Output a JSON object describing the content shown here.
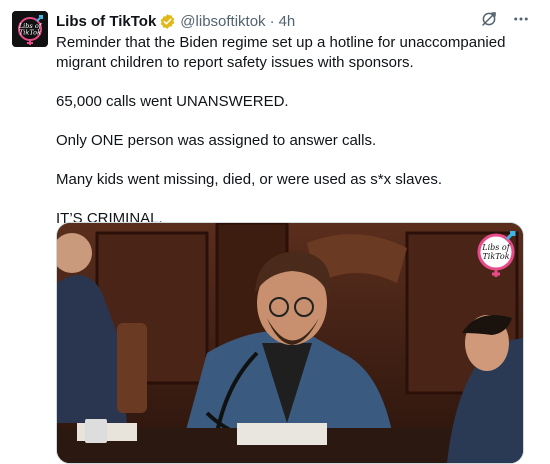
{
  "tweet": {
    "display_name": "Libs of TikTok",
    "handle": "@libsoftiktok",
    "separator": "·",
    "time": "4h",
    "avatar_text": [
      "Libs of",
      "TikTok"
    ],
    "verified_color": "#e2b719",
    "paragraphs": [
      [
        "Reminder that the Biden regime set up a hotline for unaccompanied",
        "migrant children to report safety issues with sponsors."
      ],
      [
        "65,000 calls went UNANSWERED."
      ],
      [
        "Only ONE person was assigned to answer calls."
      ],
      [
        "Many kids went missing, died, or were used as s*x slaves."
      ],
      [
        "IT’S CRIMINAL."
      ]
    ]
  },
  "media": {
    "watermark_text": [
      "Libs of",
      "TikTok"
    ],
    "description_icons": [
      "grok-icon",
      "more-icon"
    ]
  }
}
